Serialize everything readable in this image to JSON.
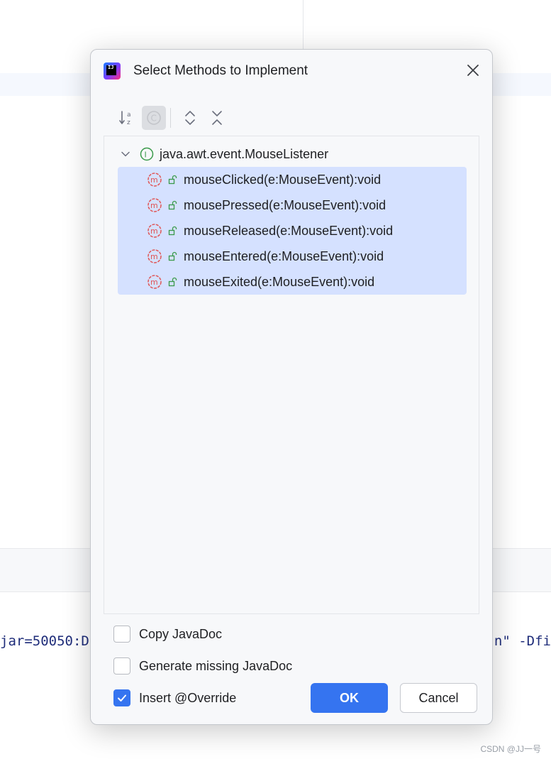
{
  "background": {
    "console_left": "jar=50050:D",
    "console_right": "n\" -Dfi",
    "watermark": "CSDN @JJ一号"
  },
  "dialog": {
    "title": "Select Methods to Implement",
    "app_icon_text": "IJ",
    "toolbar": {
      "sort_alpha_icon": "sort-alphabetically-icon",
      "show_classes_icon": "show-classes-icon",
      "expand_all_icon": "expand-all-icon",
      "collapse_all_icon": "collapse-all-icon"
    },
    "tree": {
      "root_label": "java.awt.event.MouseListener",
      "root_icon": "I",
      "methods": [
        {
          "label": "mouseClicked(e:MouseEvent):void"
        },
        {
          "label": "mousePressed(e:MouseEvent):void"
        },
        {
          "label": "mouseReleased(e:MouseEvent):void"
        },
        {
          "label": "mouseEntered(e:MouseEvent):void"
        },
        {
          "label": "mouseExited(e:MouseEvent):void"
        }
      ]
    },
    "options": {
      "copy_javadoc": {
        "label": "Copy JavaDoc",
        "checked": false
      },
      "generate_missing_javadoc": {
        "label": "Generate missing JavaDoc",
        "checked": false
      },
      "insert_override": {
        "label": "Insert @Override",
        "checked": true
      }
    },
    "buttons": {
      "ok": "OK",
      "cancel": "Cancel"
    },
    "colors": {
      "accent": "#3574f0",
      "selection": "#d5e1ff",
      "method_icon": "#e05555",
      "interface_icon": "#3a9a4a"
    }
  }
}
